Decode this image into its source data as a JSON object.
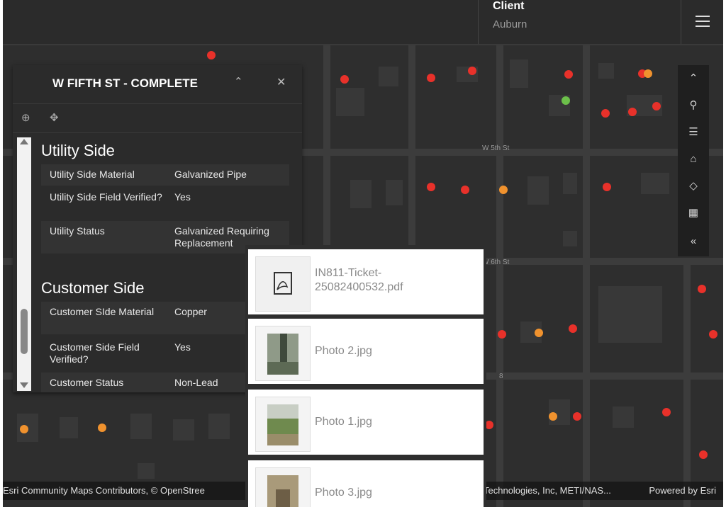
{
  "header": {
    "client_title": "Client",
    "client_name": "Auburn",
    "menu_icon": "hamburger-menu-icon"
  },
  "map": {
    "street_labels": [
      "W 5th St",
      "W 6th St",
      "8"
    ],
    "attribution_left": "Esri Community Maps Contributors, © OpenStree",
    "attribution_mid": "Technologies, Inc, METI/NAS...",
    "attribution_right": "Powered by Esri",
    "colors": {
      "red": "#e8312a",
      "orange": "#f0922e",
      "green": "#6cc04a"
    }
  },
  "toolbar": {
    "icons": [
      "collapse-up-icon",
      "search-icon",
      "legend-list-icon",
      "home-icon",
      "layers-icon",
      "qr-code-icon",
      "expand-left-icon"
    ]
  },
  "popup": {
    "title": "W FIFTH ST - COMPLETE",
    "collapse_icon": "chevron-up-icon",
    "close_icon": "close-icon",
    "actions": [
      "zoom-to-icon",
      "pan-move-icon"
    ],
    "sections": [
      {
        "title": "Utility Side",
        "rows": [
          {
            "label": "Utility Side Material",
            "value": "Galvanized Pipe"
          },
          {
            "label": "Utility Side Field Verified?",
            "value": "Yes"
          },
          {
            "label": "Utility Status",
            "value": "Galvanized Requiring Replacement"
          }
        ]
      },
      {
        "title": "Customer Side",
        "rows": [
          {
            "label": "Customer SIde Material",
            "value": "Copper"
          },
          {
            "label": "Customer Side Field Verified?",
            "value": "Yes"
          },
          {
            "label": "Customer Status",
            "value": "Non-Lead"
          }
        ]
      }
    ]
  },
  "attachments": [
    {
      "name": "IN811-Ticket-25082400532.pdf",
      "icon": "pdf-file-icon"
    },
    {
      "name": "Photo 2.jpg"
    },
    {
      "name": "Photo 1.jpg"
    },
    {
      "name": "Photo 3.jpg"
    }
  ]
}
